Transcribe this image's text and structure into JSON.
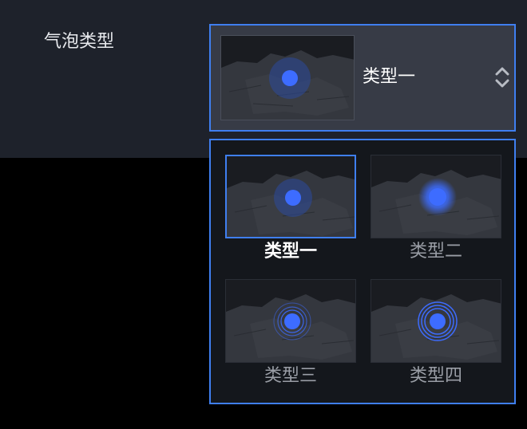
{
  "field": {
    "label": "气泡类型"
  },
  "select": {
    "value": "类型一",
    "sort_icon": "sort-updown-icon"
  },
  "options": [
    {
      "label": "类型一",
      "style": "halo",
      "selected": true
    },
    {
      "label": "类型二",
      "style": "glow",
      "selected": false
    },
    {
      "label": "类型三",
      "style": "thin-rings",
      "selected": false
    },
    {
      "label": "类型四",
      "style": "multi-rings",
      "selected": false
    }
  ],
  "colors": {
    "accent": "#3f7ff0",
    "bubble": "#3d6cff",
    "panel": "#1e222b",
    "select_bg": "#373b46",
    "dropdown_bg": "#14171c",
    "map_land": "#3a3d44",
    "map_bg": "#1a1c21"
  }
}
